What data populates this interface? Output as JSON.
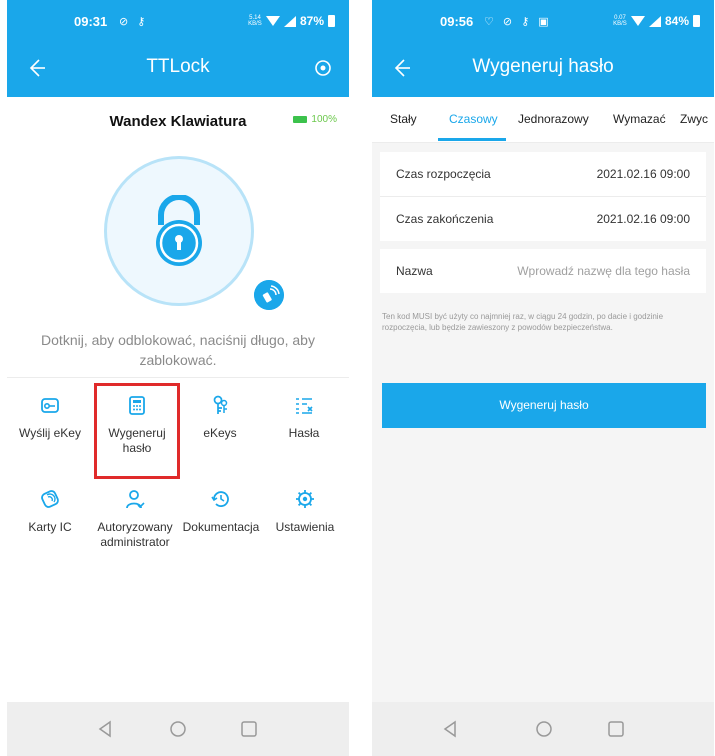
{
  "left": {
    "status": {
      "time": "09:31",
      "icons": "⊘ ⚷",
      "net": "5.14 KB/S",
      "battery": "87%"
    },
    "title": "TTLock",
    "lock_name": "Wandex Klawiatura",
    "battery_level": "100%",
    "hint": "Dotknij, aby odblokować, naciśnij długo, aby zablokować.",
    "menu": [
      {
        "label": "Wyślij eKey",
        "icon": "send-key-icon"
      },
      {
        "label": "Wygeneruj hasło",
        "icon": "keypad-icon"
      },
      {
        "label": "eKeys",
        "icon": "ekeys-icon"
      },
      {
        "label": "Hasła",
        "icon": "passwords-list-icon"
      },
      {
        "label": "Karty IC",
        "icon": "ic-card-icon"
      },
      {
        "label": "Autoryzowany administrator",
        "icon": "admin-user-icon"
      },
      {
        "label": "Dokumentacja",
        "icon": "history-clock-icon"
      },
      {
        "label": "Ustawienia",
        "icon": "settings-gear-icon"
      }
    ]
  },
  "right": {
    "status": {
      "time": "09:56",
      "net": "0.07 KB/S",
      "battery": "84%"
    },
    "title": "Wygeneruj hasło",
    "tabs": [
      "Stały",
      "Czasowy",
      "Jednorazowy",
      "Wymazać",
      "Zwyc"
    ],
    "active_tab": "Czasowy",
    "start_label": "Czas rozpoczęcia",
    "start_value": "2021.02.16 09:00",
    "end_label": "Czas zakończenia",
    "end_value": "2021.02.16 09:00",
    "name_label": "Nazwa",
    "name_placeholder": "Wprowadź nazwę dla tego hasła",
    "note": "Ten kod MUSI być użyty co najmniej raz, w ciągu 24 godzin, po dacie i godzinie rozpoczęcia, lub będzie zawieszony z powodów bezpieczeństwa.",
    "generate_button": "Wygeneruj hasło"
  },
  "colors": {
    "accent": "#1aa7ea",
    "highlight": "#e02a2a",
    "battery_green": "#3cc24c"
  }
}
